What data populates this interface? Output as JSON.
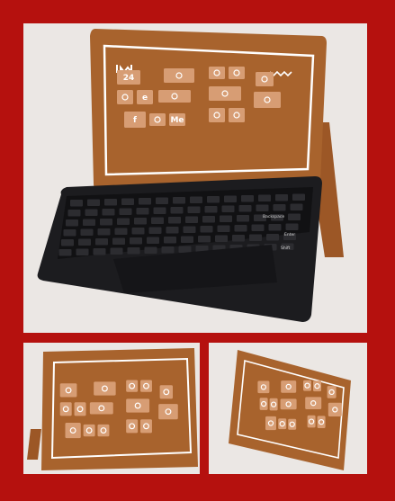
{
  "scene": {
    "type": "photo-collage",
    "colors": {
      "border": "#b5110e",
      "background": "#ebe7e4",
      "gingerbread": "#a8632d",
      "icing": "#ffffff",
      "tile": "#d79d74",
      "keyboard": "#1c1c1f"
    }
  },
  "tablet": {
    "tiles": [
      {
        "icon": "calendar-icon",
        "label": "24"
      },
      {
        "icon": "mail-icon",
        "label": ""
      },
      {
        "icon": "play-icon",
        "label": ""
      },
      {
        "icon": "heart-icon",
        "label": ""
      },
      {
        "icon": "people-icon",
        "label": ""
      },
      {
        "icon": "message-icon",
        "label": ""
      },
      {
        "icon": "ie-icon",
        "label": "e"
      },
      {
        "icon": "headphones-icon",
        "label": ""
      },
      {
        "icon": "tv-icon",
        "label": ""
      },
      {
        "icon": "signature-icon",
        "label": ""
      },
      {
        "icon": "facebook-icon",
        "label": "f"
      },
      {
        "icon": "grid-icon",
        "label": ""
      },
      {
        "icon": "me-icon",
        "label": "Me"
      },
      {
        "icon": "settings-icon",
        "label": ""
      },
      {
        "icon": "trophy-icon",
        "label": ""
      }
    ]
  },
  "keyboard": {
    "keys": [
      "Backspace",
      "Enter",
      "Shift"
    ]
  }
}
